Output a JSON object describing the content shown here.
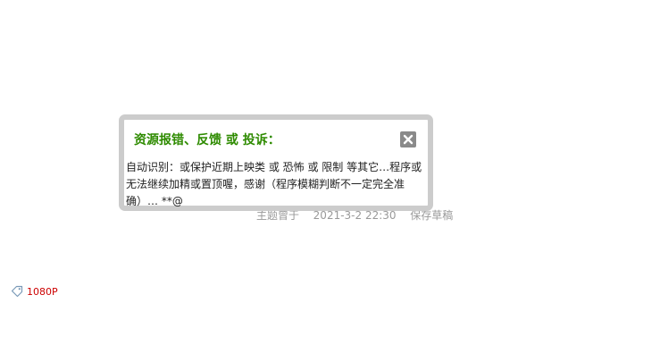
{
  "popup": {
    "title": "资源报错、反馈 或 投诉：",
    "close_icon": "close-icon",
    "body_lines": [
      "自动识别：或保护近期上映类 或 恐怖 或 限制 等其它…程序或",
      "无法继续加精或置顶喔，感谢（程序模糊判断不一定完全准",
      "确）… **@"
    ]
  },
  "post_meta": {
    "prefix": "主题曾于",
    "datetime": "2021-3-2 22:30",
    "action": "保存草稿"
  },
  "tag": {
    "icon": "tag-icon",
    "label": "1080P"
  },
  "colors": {
    "title_green": "#2e8b00",
    "meta_gray": "#999999",
    "tag_red": "#cc0000",
    "border_gray": "#cccccc",
    "close_bg": "#8a8a8a"
  }
}
